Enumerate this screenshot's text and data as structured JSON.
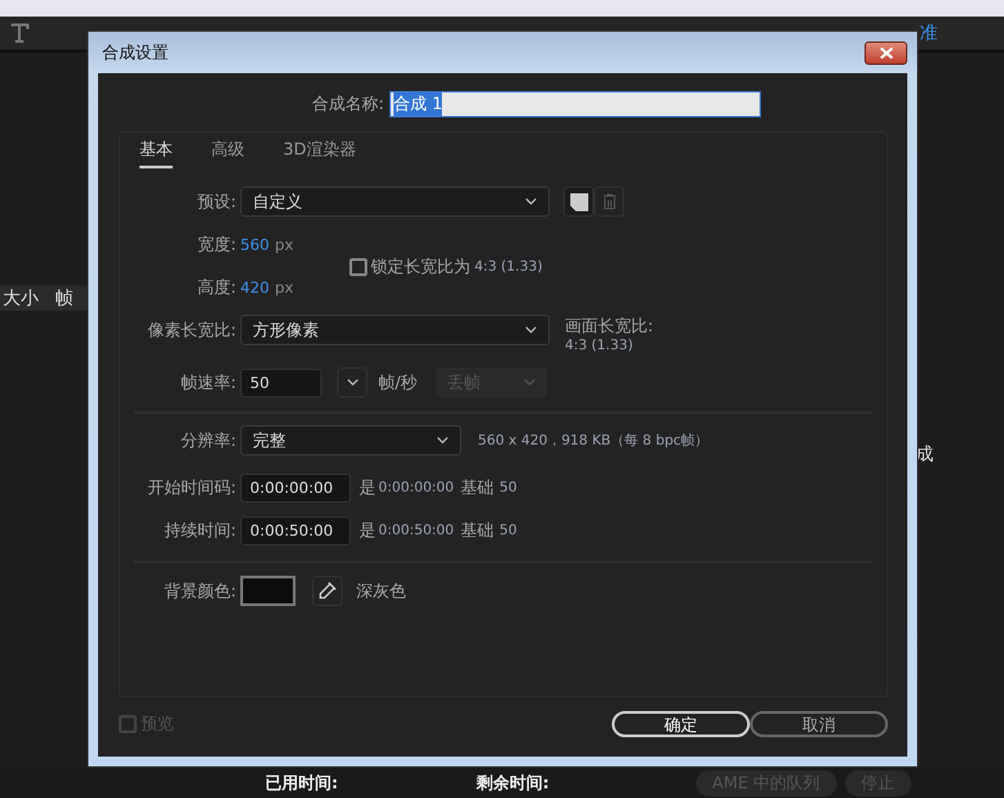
{
  "workspace": {
    "label": "准",
    "selected": true
  },
  "panel_columns": [
    "大小",
    "帧"
  ],
  "side_text": "成",
  "status": {
    "elapsed_label": "已用时间:",
    "remaining_label": "剩余时间:"
  },
  "queue_buttons": [
    {
      "label": "AME 中的队列",
      "disabled": true
    },
    {
      "label": "停止",
      "disabled": true
    }
  ],
  "dialog": {
    "title": "合成设置",
    "name_label": "合成名称:",
    "name_value": "合成 1",
    "name_selected": true,
    "tabs": [
      {
        "label": "基本",
        "selected": true
      },
      {
        "label": "高级",
        "selected": false
      },
      {
        "label": "3D渲染器",
        "selected": false
      }
    ],
    "preset": {
      "label": "预设:",
      "value": "自定义"
    },
    "width": {
      "label": "宽度:",
      "value": "560",
      "unit": "px"
    },
    "height": {
      "label": "高度:",
      "value": "420",
      "unit": "px"
    },
    "lock": {
      "label": "锁定长宽比为",
      "checked": false,
      "ratio": "4:3 (1.33)"
    },
    "pixel_aspect": {
      "label": "像素长宽比:",
      "value": "方形像素"
    },
    "frame_aspect": {
      "label": "画面长宽比:",
      "value": "4:3 (1.33)"
    },
    "frame_rate": {
      "label": "帧速率:",
      "value": "50",
      "unit": "帧/秒",
      "drop_frame": "丢帧",
      "drop_disabled": true
    },
    "resolution": {
      "label": "分辨率:",
      "value": "完整",
      "info": "560 x 420，918 KB（每 8 bpc帧）"
    },
    "timecodes": [
      {
        "label": "开始时间码:",
        "value": "0:00:00:00",
        "is_label": "是",
        "is_value": "0:00:00:00",
        "base_label": "基础",
        "base_value": "50"
      },
      {
        "label": "持续时间:",
        "value": "0:00:50:00",
        "is_label": "是",
        "is_value": "0:00:50:00",
        "base_label": "基础",
        "base_value": "50"
      }
    ],
    "background": {
      "label": "背景颜色:",
      "color": "#0c0c0c",
      "name": "深灰色"
    },
    "preview": {
      "label": "预览",
      "checked": false,
      "disabled": true
    },
    "buttons": [
      {
        "label": "确定",
        "kind": "primary"
      },
      {
        "label": "取消",
        "kind": "secondary"
      }
    ]
  }
}
